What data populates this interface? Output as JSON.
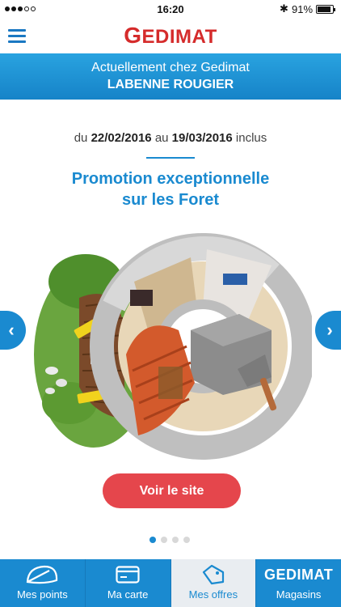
{
  "status_bar": {
    "time": "16:20",
    "battery_pct": "91%",
    "battery_level": 0.91
  },
  "header": {
    "logo_text": "Gedimat",
    "logo_initial": "G",
    "logo_rest": "EDIMAT",
    "menu_icon": "hamburger-menu-icon",
    "logo_color": "#d52b2b",
    "accent_color": "#1a8ad0"
  },
  "store_banner": {
    "line1": "Actuellement chez Gedimat",
    "line2": "LABENNE ROUGIER"
  },
  "offer": {
    "date_prefix": "du",
    "date_start": "22/02/2016",
    "date_mid": "au",
    "date_end": "19/03/2016",
    "date_suffix": "inclus",
    "title_line1": "Promotion exceptionnelle",
    "title_line2": "sur les Foret"
  },
  "carousel": {
    "prev_icon": "chevron-left-icon",
    "next_icon": "chevron-right-icon",
    "prev_glyph": "‹",
    "next_glyph": "›",
    "page_count": 4,
    "active_page": 1
  },
  "cta": {
    "label": "Voir le site",
    "color": "#e5464c"
  },
  "tabs": [
    {
      "label": "Mes points",
      "icon": "leaf-icon",
      "active": false
    },
    {
      "label": "Ma carte",
      "icon": "card-icon",
      "active": false
    },
    {
      "label": "Mes offres",
      "icon": "tag-icon",
      "active": true
    },
    {
      "label": "Magasins",
      "icon": "gedimat-brand-icon",
      "brand_text": "GEDIMAT",
      "active": false
    }
  ]
}
